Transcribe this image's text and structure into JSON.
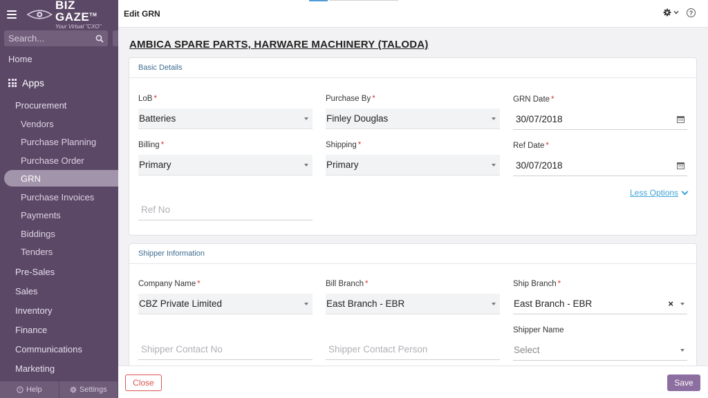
{
  "colors": {
    "sidebar_bg": "#5b4866",
    "accent": "#8c6ea0",
    "link": "#3fa3d7",
    "danger": "#d9534f",
    "required": "#dd3333"
  },
  "brand": {
    "name": "BIZ GAZE",
    "tm": "TM",
    "tagline": "Your Virtual \"CXO\""
  },
  "sidebar": {
    "search_placeholder": "Search...",
    "home": "Home",
    "apps": "Apps",
    "procurement": "Procurement",
    "procurement_items": [
      "Vendors",
      "Purchase Planning",
      "Purchase Order",
      "GRN",
      "Purchase Invoices",
      "Payments",
      "Biddings",
      "Tenders"
    ],
    "active_item": "GRN",
    "groups": [
      "Pre-Sales",
      "Sales",
      "Inventory",
      "Finance",
      "Communications",
      "Marketing"
    ],
    "footer": {
      "help": "Help",
      "settings": "Settings"
    }
  },
  "header": {
    "title": "Edit GRN",
    "icons": [
      "gear-icon",
      "chevron-down-icon",
      "help-icon"
    ]
  },
  "vendor_title": "AMBICA SPARE PARTS, HARWARE MACHINERY (TALODA)",
  "basic_details": {
    "heading": "Basic Details",
    "lob": {
      "label": "LoB",
      "value": "Batteries"
    },
    "purchase_by": {
      "label": "Purchase By",
      "value": "Finley Douglas"
    },
    "grn_date": {
      "label": "GRN Date",
      "value": "30/07/2018"
    },
    "billing": {
      "label": "Billing",
      "value": "Primary"
    },
    "shipping": {
      "label": "Shipping",
      "value": "Primary"
    },
    "ref_date": {
      "label": "Ref Date",
      "value": "30/07/2018"
    },
    "less_options": "Less Options",
    "ref_no": {
      "placeholder": "Ref No"
    }
  },
  "shipper_info": {
    "heading": "Shipper Information",
    "company_name": {
      "label": "Company Name",
      "value": "CBZ Private Limited"
    },
    "bill_branch": {
      "label": "Bill Branch",
      "value": "East Branch - EBR"
    },
    "ship_branch": {
      "label": "Ship Branch",
      "value": "East Branch - EBR",
      "clear": "×"
    },
    "shipper_contact_no": {
      "placeholder": "Shipper Contact No"
    },
    "shipper_contact_person": {
      "placeholder": "Shipper Contact Person"
    },
    "shipper_name": {
      "label": "Shipper Name",
      "placeholder": "Select"
    }
  },
  "footer": {
    "close": "Close",
    "save": "Save"
  }
}
